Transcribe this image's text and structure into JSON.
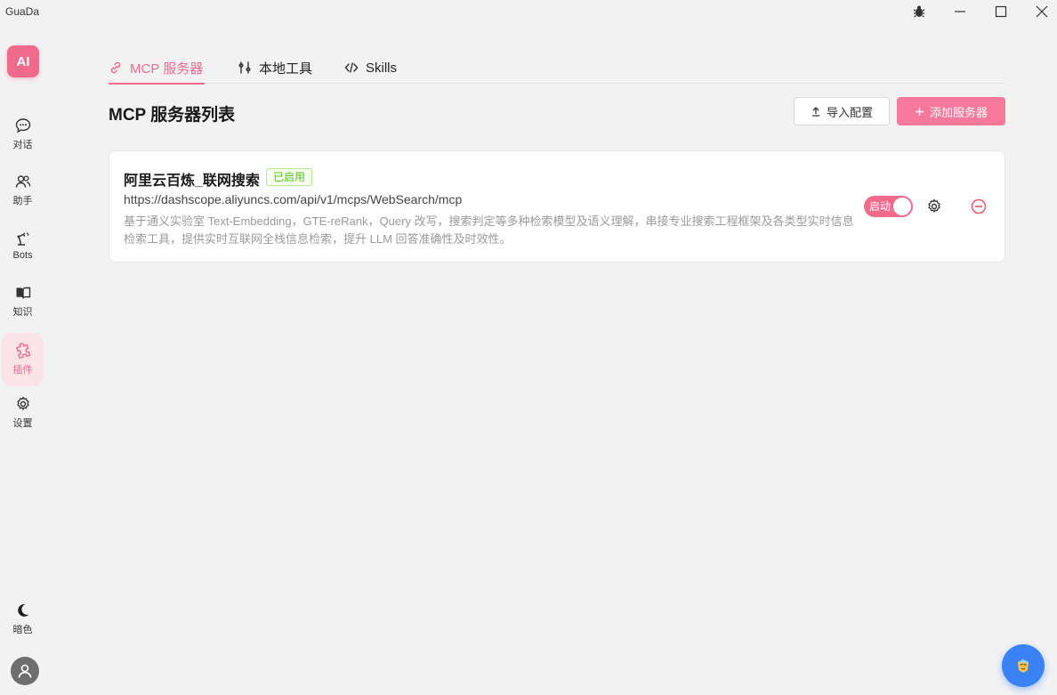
{
  "app": {
    "title": "GuaDa",
    "logo_text": "AI"
  },
  "sidebar": {
    "items": [
      {
        "label": "对话",
        "icon": "chat-bubble-icon"
      },
      {
        "label": "助手",
        "icon": "users-icon"
      },
      {
        "label": "Bots",
        "icon": "robot-arm-icon"
      },
      {
        "label": "知识",
        "icon": "book-icon"
      },
      {
        "label": "插件",
        "icon": "puzzle-icon",
        "active": true
      },
      {
        "label": "设置",
        "icon": "gear-icon"
      }
    ],
    "theme_toggle": {
      "label": "暗色",
      "icon": "moon-icon"
    }
  },
  "tabs": [
    {
      "label": "MCP 服务器",
      "icon": "link-icon",
      "active": true
    },
    {
      "label": "本地工具",
      "icon": "tools-icon"
    },
    {
      "label": "Skills",
      "icon": "code-icon"
    }
  ],
  "main": {
    "title": "MCP 服务器列表",
    "import_label": "导入配置",
    "add_label": "添加服务器"
  },
  "servers": [
    {
      "name": "阿里云百炼_联网搜索",
      "status": "已启用",
      "url": "https://dashscope.aliyuncs.com/api/v1/mcps/WebSearch/mcp",
      "description": "基于通义实验室 Text-Embedding，GTE-reRank，Query 改写，搜索判定等多种检索模型及语义理解，串接专业搜索工程框架及各类型实时信息检索工具，提供实时互联网全栈信息检索，提升 LLM 回答准确性及时效性。",
      "toggle_label": "启动",
      "enabled": true
    }
  ],
  "colors": {
    "accent": "#f06a8c",
    "button": "#f6789a",
    "fab": "#3b82f6",
    "badge_green": "#52c41a"
  }
}
